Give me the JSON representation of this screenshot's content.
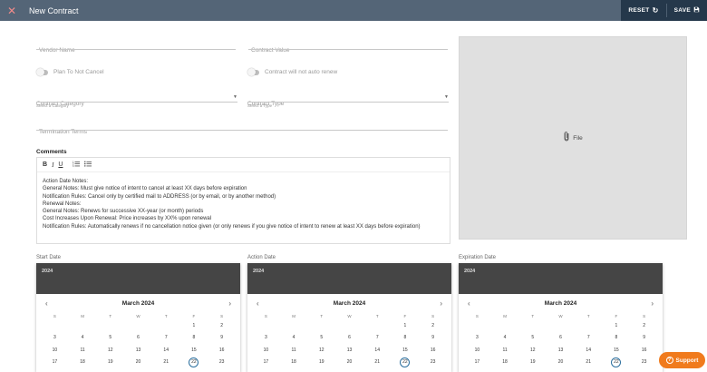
{
  "header": {
    "title": "New Contract",
    "close_icon": "close-icon",
    "reset_label": "RESET",
    "save_label": "SAVE",
    "bg_color": "#546577",
    "actions_bg": "#25384b"
  },
  "form": {
    "vendor_name_placeholder": "Vendor Name",
    "contract_value_placeholder": "Contract Value",
    "toggle_plan_not_cancel": "Plan To Not Cancel",
    "toggle_no_auto_renew": "Contract will not auto renew",
    "contract_category_placeholder": "Contract Category",
    "contract_category_helper": "Select a Category",
    "contract_type_placeholder": "Contract Type",
    "contract_type_helper": "Select a Type",
    "termination_terms_placeholder": "Termination Terms"
  },
  "comments": {
    "title": "Comments",
    "toolbar": {
      "bold": "B",
      "italic": "I",
      "underline": "U"
    },
    "lines": [
      "Action Date Notes:",
      "General Notes: Must give notice of intent to cancel at least XX days before expiration",
      "Notification Rules: Cancel only by certified mail to ADDRESS (or by email, or by another method)",
      "Renewal Notes:",
      "General Notes: Renews for successive XX-year (or month) periods",
      "Cost Increases Upon Renewal: Price increases by XX% upon renewal",
      "Notification Rules: Automatically renews if no cancellation notice given (or only renews if you give notice of intent to renew at least XX days before expiration)"
    ]
  },
  "file": {
    "label": "File"
  },
  "calendars": [
    {
      "label": "Start Date",
      "year": "2024",
      "month": "March 2024"
    },
    {
      "label": "Action Date",
      "year": "2024",
      "month": "March 2024"
    },
    {
      "label": "Expiration Date",
      "year": "2024",
      "month": "March 2024"
    }
  ],
  "calendar_common": {
    "dow": [
      "S",
      "M",
      "T",
      "W",
      "T",
      "F",
      "S"
    ],
    "weeks": [
      [
        "",
        "",
        "",
        "",
        "",
        "1",
        "2"
      ],
      [
        "3",
        "4",
        "5",
        "6",
        "7",
        "8",
        "9"
      ],
      [
        "10",
        "11",
        "12",
        "13",
        "14",
        "15",
        "16"
      ],
      [
        "17",
        "18",
        "19",
        "20",
        "21",
        "22",
        "23"
      ]
    ],
    "today": "22"
  },
  "support": {
    "label": "Support",
    "color": "#f07b1d"
  }
}
